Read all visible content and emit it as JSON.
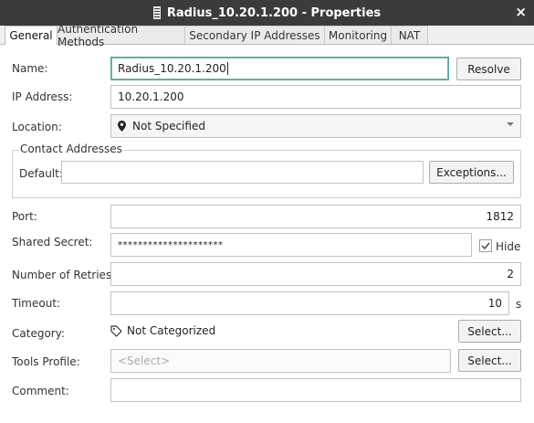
{
  "window": {
    "title": "Radius_10.20.1.200 - Properties",
    "close_glyph": "×"
  },
  "tabs": [
    {
      "label": "General"
    },
    {
      "label": "Authentication Methods"
    },
    {
      "label": "Secondary IP Addresses"
    },
    {
      "label": "Monitoring"
    },
    {
      "label": "NAT"
    }
  ],
  "form": {
    "name": {
      "label": "Name:",
      "value": "Radius_10.20.1.200",
      "button": "Resolve"
    },
    "ip": {
      "label": "IP Address:",
      "value": "10.20.1.200"
    },
    "location": {
      "label": "Location:",
      "value": "Not Specified",
      "icon": "pin-icon"
    },
    "contact": {
      "group": "Contact Addresses",
      "default_label": "Default:",
      "default_value": "",
      "button": "Exceptions..."
    },
    "port": {
      "label": "Port:",
      "value": "1812"
    },
    "secret": {
      "label": "Shared Secret:",
      "value": "*********************",
      "hide_label": "Hide",
      "hide_checked": true
    },
    "retries": {
      "label": "Number of Retries:",
      "value": "2"
    },
    "timeout": {
      "label": "Timeout:",
      "value": "10",
      "unit": "s"
    },
    "category": {
      "label": "Category:",
      "value": "Not Categorized",
      "icon": "tag-icon",
      "button": "Select..."
    },
    "tools": {
      "label": "Tools Profile:",
      "placeholder": "<Select>",
      "button": "Select..."
    },
    "comment": {
      "label": "Comment:",
      "value": ""
    }
  },
  "colors": {
    "titlebar": "#3b3b3b",
    "focus": "#4fa7a1"
  }
}
